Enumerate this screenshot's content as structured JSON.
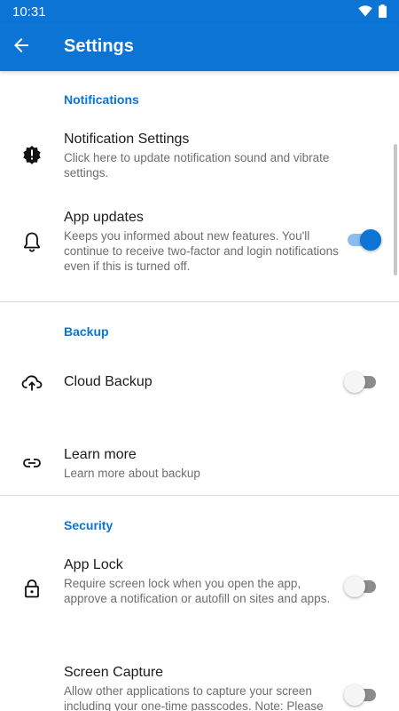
{
  "status_bar": {
    "time": "10:31",
    "icons": [
      "wifi-icon",
      "battery-icon"
    ]
  },
  "app_bar": {
    "title": "Settings",
    "back_icon": "arrow-back-icon"
  },
  "sections": {
    "notifications": {
      "header": "Notifications",
      "notification_settings": {
        "title": "Notification Settings",
        "description": "Click here to update notification sound and vibrate settings."
      },
      "app_updates": {
        "title": "App updates",
        "description": "Keeps you informed about new features. You'll continue to receive two-factor and login notifications even if this is turned off.",
        "enabled": true
      }
    },
    "backup": {
      "header": "Backup",
      "cloud_backup": {
        "title": "Cloud Backup",
        "enabled": false
      },
      "learn_more": {
        "title": "Learn more",
        "description": "Learn more about backup"
      }
    },
    "security": {
      "header": "Security",
      "app_lock": {
        "title": "App Lock",
        "description": "Require screen lock when you open the app, approve a notification or autofill on sites and apps.",
        "enabled": false
      },
      "screen_capture": {
        "title": "Screen Capture",
        "description": "Allow other applications to capture your screen including your one-time passcodes. Note: Please",
        "enabled": false
      }
    }
  },
  "colors": {
    "primary": "#0b74d4",
    "toggle_on_track": "#8cbdf0",
    "toggle_off_track": "#8c8c8c",
    "section_header": "#0b74d4"
  }
}
